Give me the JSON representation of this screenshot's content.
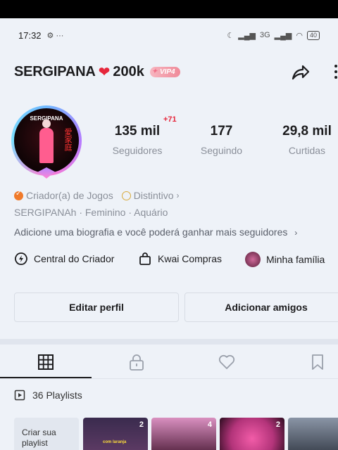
{
  "status_bar": {
    "time": "17:32",
    "icons": "⚙ ···",
    "network": "3G",
    "battery": "40"
  },
  "profile": {
    "username": "SERGIPANA",
    "follower_tag": "200k",
    "vip_label": "VIP4",
    "avatar_caption": "SERGIPANA",
    "stats": [
      {
        "value": "135 mil",
        "label": "Seguidores"
      },
      {
        "value": "177",
        "label": "Seguindo"
      },
      {
        "value": "29,8 mil",
        "label": "Curtidas"
      }
    ],
    "new_followers_badge": "+71",
    "creator_tag": "Criador(a) de Jogos",
    "distinct_tag": "Distintivo",
    "info": "SERGIPANAh · Feminino · Aquário",
    "bio_prompt": "Adicione uma biografia e você poderá ganhar mais seguidores"
  },
  "shortcuts": [
    {
      "label": "Central do Criador",
      "icon": "creator-center-icon"
    },
    {
      "label": "Kwai Compras",
      "icon": "shopping-bag-icon"
    },
    {
      "label": "Minha família",
      "icon": "family-avatar"
    }
  ],
  "buttons": {
    "edit": "Editar perfil",
    "add_friends": "Adicionar amigos"
  },
  "tabs": [
    "grid-icon",
    "lock-icon",
    "heart-icon",
    "bookmark-icon"
  ],
  "playlists": {
    "label": "36 Playlists",
    "create_label": "Criar sua playlist",
    "thumbs": [
      {
        "count": "2",
        "caption": "com laranja"
      },
      {
        "count": "4",
        "caption": ""
      },
      {
        "count": "2",
        "caption": ""
      },
      {
        "count": "",
        "caption": ""
      }
    ]
  }
}
